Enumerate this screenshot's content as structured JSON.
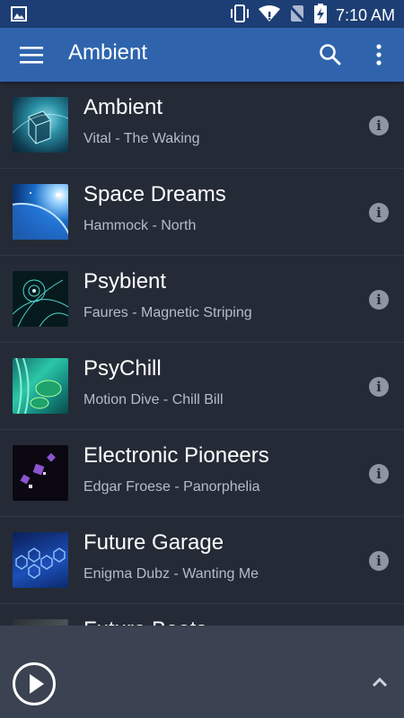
{
  "status_bar": {
    "time": "7:10 AM",
    "icons": [
      "image-icon",
      "vibrate-icon",
      "wifi-icon",
      "no-sim-icon",
      "battery-charging-icon"
    ]
  },
  "app_bar": {
    "title": "Ambient",
    "icons": [
      "menu-icon",
      "search-icon",
      "more-vert-icon"
    ],
    "color": "#2f64ad"
  },
  "stations": [
    {
      "name": "Ambient",
      "now_playing": "Vital - The Waking"
    },
    {
      "name": "Space Dreams",
      "now_playing": "Hammock - North"
    },
    {
      "name": "Psybient",
      "now_playing": "Faures - Magnetic Striping"
    },
    {
      "name": "PsyChill",
      "now_playing": "Motion Dive - Chill Bill"
    },
    {
      "name": "Electronic Pioneers",
      "now_playing": "Edgar Froese - Panorphelia"
    },
    {
      "name": "Future Garage",
      "now_playing": "Enigma Dubz - Wanting Me"
    },
    {
      "name": "Future Beats",
      "now_playing": ""
    }
  ],
  "player": {
    "icons": [
      "play-icon",
      "chevron-up-icon"
    ]
  },
  "colors": {
    "background": "#252b36",
    "status_bar": "#1d3e74",
    "player_bar": "#3b4252"
  }
}
